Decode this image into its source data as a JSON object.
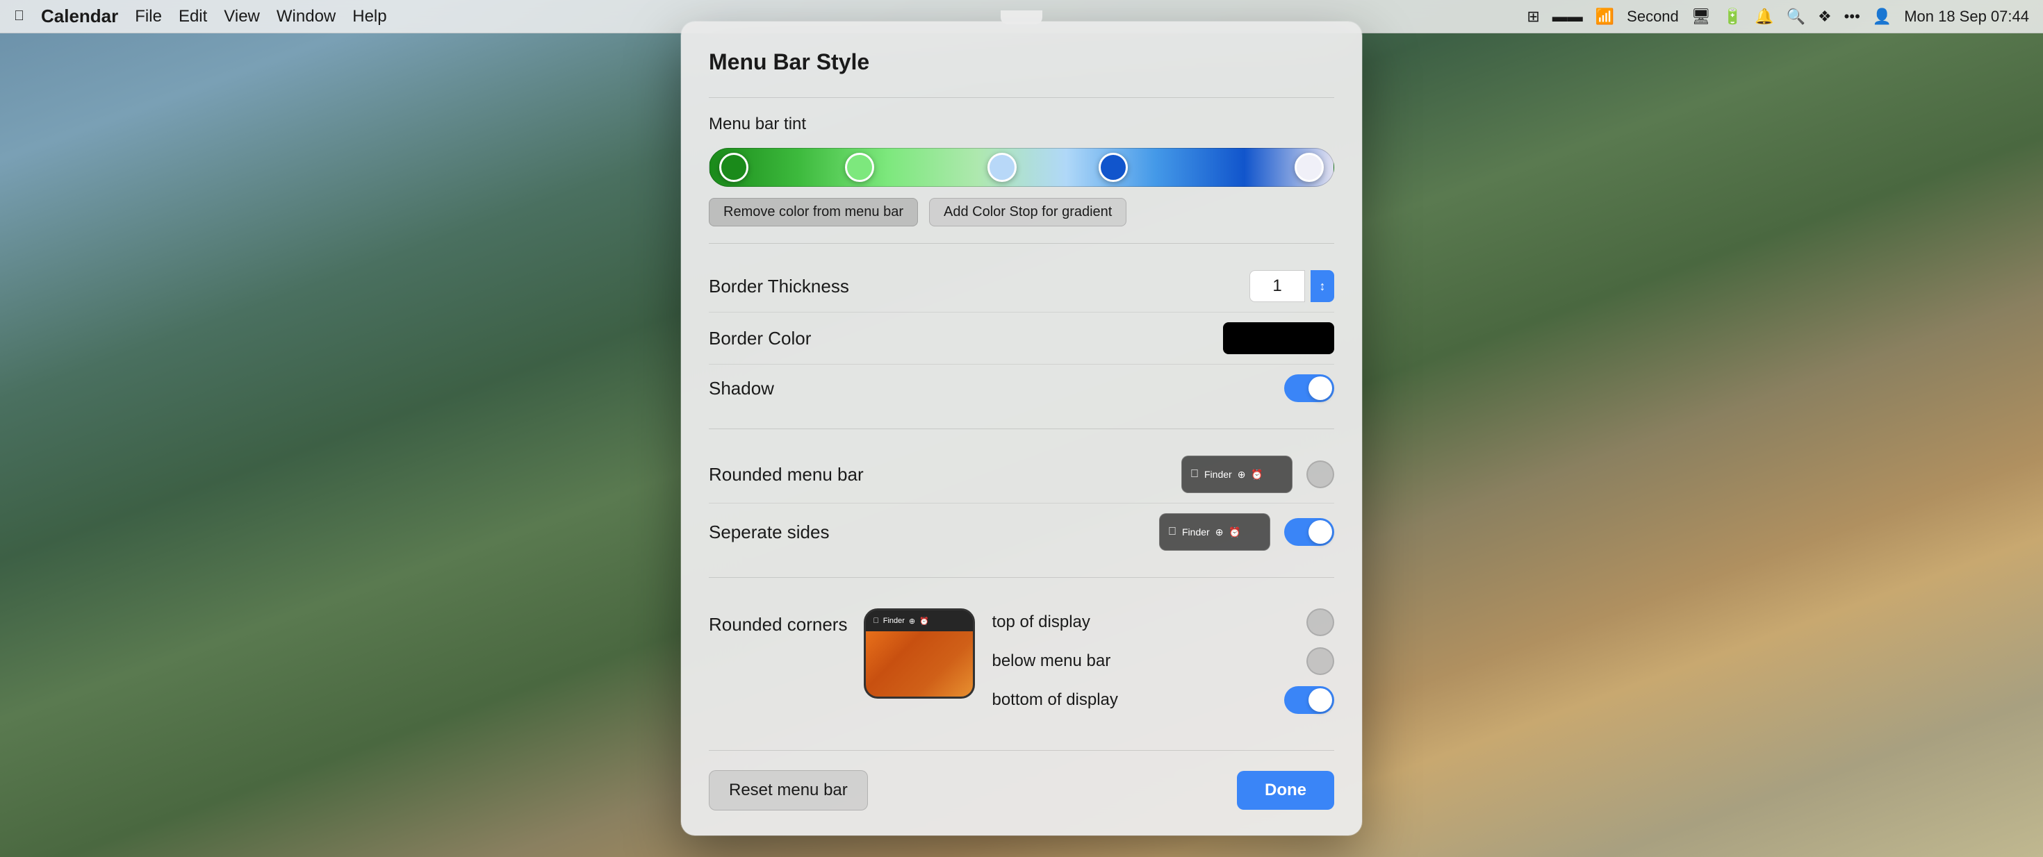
{
  "menubar": {
    "apple_label": "",
    "app_label": "Calendar",
    "items": [
      "File",
      "Edit",
      "View",
      "Window",
      "Help"
    ],
    "right_icons": [
      "⊞",
      "▬",
      "WiFi",
      "Second",
      "🖥",
      "🔋",
      "🔔",
      "🔍",
      "Dropbox",
      "···",
      "👤"
    ],
    "datetime": "Mon 18 Sep  07:44"
  },
  "dialog": {
    "title": "Menu Bar Style",
    "notch": true,
    "tint_section": {
      "label": "Menu bar tint",
      "remove_btn": "Remove color from menu bar",
      "add_btn": "Add Color Stop for gradient"
    },
    "border_thickness": {
      "label": "Border Thickness",
      "value": "1"
    },
    "border_color": {
      "label": "Border Color",
      "color": "#000000"
    },
    "shadow": {
      "label": "Shadow",
      "enabled": true
    },
    "rounded_menu_bar": {
      "label": "Rounded menu bar",
      "enabled": false
    },
    "separate_sides": {
      "label": "Seperate sides",
      "enabled": true
    },
    "rounded_corners": {
      "label": "Rounded corners",
      "top_of_display": {
        "label": "top of display",
        "enabled": false
      },
      "below_menu_bar": {
        "label": "below menu bar",
        "enabled": false
      },
      "bottom_of_display": {
        "label": "bottom of display",
        "enabled": true
      }
    },
    "footer": {
      "reset_label": "Reset menu bar",
      "done_label": "Done"
    }
  }
}
